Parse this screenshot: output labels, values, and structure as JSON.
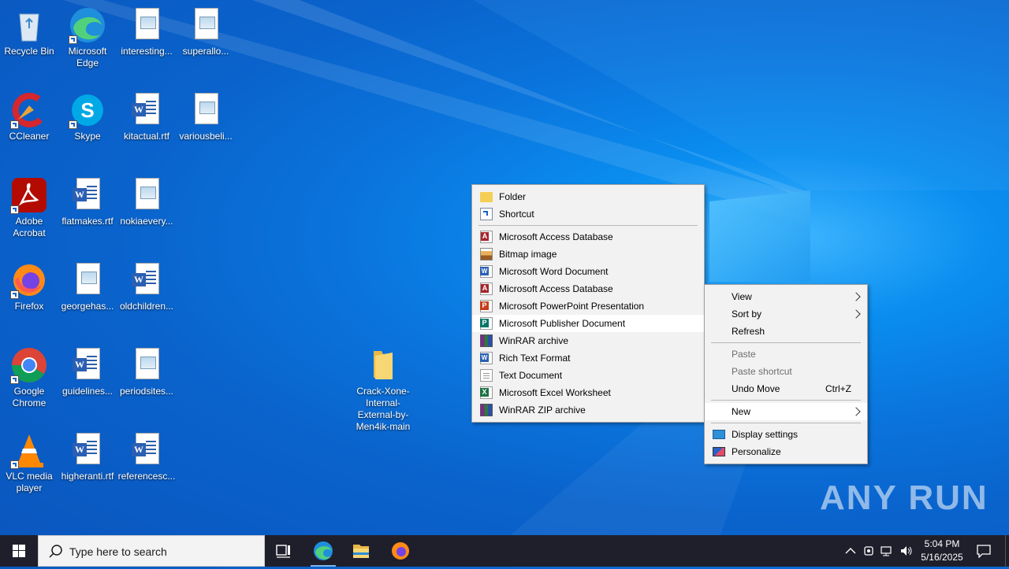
{
  "desktop": {
    "icons": [
      {
        "label": "Recycle Bin"
      },
      {
        "label": "Microsoft Edge"
      },
      {
        "label": "interesting..."
      },
      {
        "label": "superallo..."
      },
      {
        "label": "CCleaner"
      },
      {
        "label": "Skype"
      },
      {
        "label": "kitactual.rtf"
      },
      {
        "label": "variousbeli..."
      },
      {
        "label": "Adobe Acrobat"
      },
      {
        "label": "flatmakes.rtf"
      },
      {
        "label": "nokiaevery..."
      },
      {
        "label": "Firefox"
      },
      {
        "label": "georgehas..."
      },
      {
        "label": "oldchildren..."
      },
      {
        "label": "Google Chrome"
      },
      {
        "label": "guidelines..."
      },
      {
        "label": "periodsites..."
      },
      {
        "label": "VLC media player"
      },
      {
        "label": "higheranti.rtf"
      },
      {
        "label": "referencesc..."
      },
      {
        "label": "Crack-Xone-Internal-External-by-Men4ik-main"
      }
    ]
  },
  "new_submenu": {
    "items": [
      {
        "label": "Folder",
        "icon": "folder-icon"
      },
      {
        "label": "Shortcut",
        "icon": "shortcut-icon"
      },
      {
        "label": "Microsoft Access Database",
        "icon": "access-icon"
      },
      {
        "label": "Bitmap image",
        "icon": "bitmap-icon"
      },
      {
        "label": "Microsoft Word Document",
        "icon": "word-icon"
      },
      {
        "label": "Microsoft Access Database",
        "icon": "access-icon"
      },
      {
        "label": "Microsoft PowerPoint Presentation",
        "icon": "powerpoint-icon"
      },
      {
        "label": "Microsoft Publisher Document",
        "icon": "publisher-icon",
        "highlighted": true
      },
      {
        "label": "WinRAR archive",
        "icon": "winrar-icon"
      },
      {
        "label": "Rich Text Format",
        "icon": "rtf-icon"
      },
      {
        "label": "Text Document",
        "icon": "text-document-icon"
      },
      {
        "label": "Microsoft Excel Worksheet",
        "icon": "excel-icon"
      },
      {
        "label": "WinRAR ZIP archive",
        "icon": "winrar-zip-icon"
      }
    ]
  },
  "context_menu": {
    "view": "View",
    "sort_by": "Sort by",
    "refresh": "Refresh",
    "paste": "Paste",
    "paste_shortcut": "Paste shortcut",
    "undo_move": "Undo Move",
    "undo_shortcut": "Ctrl+Z",
    "new": "New",
    "display_settings": "Display settings",
    "personalize": "Personalize"
  },
  "taskbar": {
    "search_placeholder": "Type here to search",
    "time": "5:04 PM",
    "date": "5/16/2025"
  },
  "watermark": "ANY RUN",
  "colors": {
    "desktop_accent": "#0a76de",
    "taskbar": "#1f1f2c",
    "menu_bg": "#f2f2f2"
  }
}
